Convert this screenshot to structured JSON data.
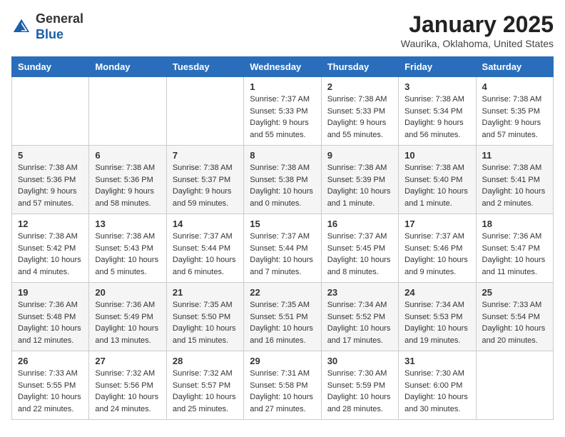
{
  "header": {
    "logo_line1": "General",
    "logo_line2": "Blue",
    "title": "January 2025",
    "subtitle": "Waurika, Oklahoma, United States"
  },
  "days_of_week": [
    "Sunday",
    "Monday",
    "Tuesday",
    "Wednesday",
    "Thursday",
    "Friday",
    "Saturday"
  ],
  "weeks": [
    [
      {
        "day": "",
        "sunrise": "",
        "sunset": "",
        "daylight": ""
      },
      {
        "day": "",
        "sunrise": "",
        "sunset": "",
        "daylight": ""
      },
      {
        "day": "",
        "sunrise": "",
        "sunset": "",
        "daylight": ""
      },
      {
        "day": "1",
        "sunrise": "Sunrise: 7:37 AM",
        "sunset": "Sunset: 5:33 PM",
        "daylight": "Daylight: 9 hours and 55 minutes."
      },
      {
        "day": "2",
        "sunrise": "Sunrise: 7:38 AM",
        "sunset": "Sunset: 5:33 PM",
        "daylight": "Daylight: 9 hours and 55 minutes."
      },
      {
        "day": "3",
        "sunrise": "Sunrise: 7:38 AM",
        "sunset": "Sunset: 5:34 PM",
        "daylight": "Daylight: 9 hours and 56 minutes."
      },
      {
        "day": "4",
        "sunrise": "Sunrise: 7:38 AM",
        "sunset": "Sunset: 5:35 PM",
        "daylight": "Daylight: 9 hours and 57 minutes."
      }
    ],
    [
      {
        "day": "5",
        "sunrise": "Sunrise: 7:38 AM",
        "sunset": "Sunset: 5:36 PM",
        "daylight": "Daylight: 9 hours and 57 minutes."
      },
      {
        "day": "6",
        "sunrise": "Sunrise: 7:38 AM",
        "sunset": "Sunset: 5:36 PM",
        "daylight": "Daylight: 9 hours and 58 minutes."
      },
      {
        "day": "7",
        "sunrise": "Sunrise: 7:38 AM",
        "sunset": "Sunset: 5:37 PM",
        "daylight": "Daylight: 9 hours and 59 minutes."
      },
      {
        "day": "8",
        "sunrise": "Sunrise: 7:38 AM",
        "sunset": "Sunset: 5:38 PM",
        "daylight": "Daylight: 10 hours and 0 minutes."
      },
      {
        "day": "9",
        "sunrise": "Sunrise: 7:38 AM",
        "sunset": "Sunset: 5:39 PM",
        "daylight": "Daylight: 10 hours and 1 minute."
      },
      {
        "day": "10",
        "sunrise": "Sunrise: 7:38 AM",
        "sunset": "Sunset: 5:40 PM",
        "daylight": "Daylight: 10 hours and 1 minute."
      },
      {
        "day": "11",
        "sunrise": "Sunrise: 7:38 AM",
        "sunset": "Sunset: 5:41 PM",
        "daylight": "Daylight: 10 hours and 2 minutes."
      }
    ],
    [
      {
        "day": "12",
        "sunrise": "Sunrise: 7:38 AM",
        "sunset": "Sunset: 5:42 PM",
        "daylight": "Daylight: 10 hours and 4 minutes."
      },
      {
        "day": "13",
        "sunrise": "Sunrise: 7:38 AM",
        "sunset": "Sunset: 5:43 PM",
        "daylight": "Daylight: 10 hours and 5 minutes."
      },
      {
        "day": "14",
        "sunrise": "Sunrise: 7:37 AM",
        "sunset": "Sunset: 5:44 PM",
        "daylight": "Daylight: 10 hours and 6 minutes."
      },
      {
        "day": "15",
        "sunrise": "Sunrise: 7:37 AM",
        "sunset": "Sunset: 5:44 PM",
        "daylight": "Daylight: 10 hours and 7 minutes."
      },
      {
        "day": "16",
        "sunrise": "Sunrise: 7:37 AM",
        "sunset": "Sunset: 5:45 PM",
        "daylight": "Daylight: 10 hours and 8 minutes."
      },
      {
        "day": "17",
        "sunrise": "Sunrise: 7:37 AM",
        "sunset": "Sunset: 5:46 PM",
        "daylight": "Daylight: 10 hours and 9 minutes."
      },
      {
        "day": "18",
        "sunrise": "Sunrise: 7:36 AM",
        "sunset": "Sunset: 5:47 PM",
        "daylight": "Daylight: 10 hours and 11 minutes."
      }
    ],
    [
      {
        "day": "19",
        "sunrise": "Sunrise: 7:36 AM",
        "sunset": "Sunset: 5:48 PM",
        "daylight": "Daylight: 10 hours and 12 minutes."
      },
      {
        "day": "20",
        "sunrise": "Sunrise: 7:36 AM",
        "sunset": "Sunset: 5:49 PM",
        "daylight": "Daylight: 10 hours and 13 minutes."
      },
      {
        "day": "21",
        "sunrise": "Sunrise: 7:35 AM",
        "sunset": "Sunset: 5:50 PM",
        "daylight": "Daylight: 10 hours and 15 minutes."
      },
      {
        "day": "22",
        "sunrise": "Sunrise: 7:35 AM",
        "sunset": "Sunset: 5:51 PM",
        "daylight": "Daylight: 10 hours and 16 minutes."
      },
      {
        "day": "23",
        "sunrise": "Sunrise: 7:34 AM",
        "sunset": "Sunset: 5:52 PM",
        "daylight": "Daylight: 10 hours and 17 minutes."
      },
      {
        "day": "24",
        "sunrise": "Sunrise: 7:34 AM",
        "sunset": "Sunset: 5:53 PM",
        "daylight": "Daylight: 10 hours and 19 minutes."
      },
      {
        "day": "25",
        "sunrise": "Sunrise: 7:33 AM",
        "sunset": "Sunset: 5:54 PM",
        "daylight": "Daylight: 10 hours and 20 minutes."
      }
    ],
    [
      {
        "day": "26",
        "sunrise": "Sunrise: 7:33 AM",
        "sunset": "Sunset: 5:55 PM",
        "daylight": "Daylight: 10 hours and 22 minutes."
      },
      {
        "day": "27",
        "sunrise": "Sunrise: 7:32 AM",
        "sunset": "Sunset: 5:56 PM",
        "daylight": "Daylight: 10 hours and 24 minutes."
      },
      {
        "day": "28",
        "sunrise": "Sunrise: 7:32 AM",
        "sunset": "Sunset: 5:57 PM",
        "daylight": "Daylight: 10 hours and 25 minutes."
      },
      {
        "day": "29",
        "sunrise": "Sunrise: 7:31 AM",
        "sunset": "Sunset: 5:58 PM",
        "daylight": "Daylight: 10 hours and 27 minutes."
      },
      {
        "day": "30",
        "sunrise": "Sunrise: 7:30 AM",
        "sunset": "Sunset: 5:59 PM",
        "daylight": "Daylight: 10 hours and 28 minutes."
      },
      {
        "day": "31",
        "sunrise": "Sunrise: 7:30 AM",
        "sunset": "Sunset: 6:00 PM",
        "daylight": "Daylight: 10 hours and 30 minutes."
      },
      {
        "day": "",
        "sunrise": "",
        "sunset": "",
        "daylight": ""
      }
    ]
  ]
}
